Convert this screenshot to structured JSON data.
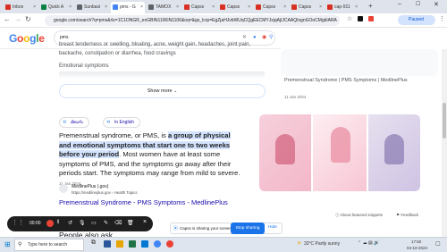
{
  "tabs": [
    {
      "label": "Inbox",
      "color": "#d93025"
    },
    {
      "label": "Quick A",
      "color": "#0b8043"
    },
    {
      "label": "Sunbasi",
      "color": "#5f6368"
    },
    {
      "label": "pms - G",
      "color": "#4285f4"
    },
    {
      "label": "TAMOX",
      "color": "#5f6368"
    },
    {
      "label": "Capss",
      "color": "#d93025"
    },
    {
      "label": "Capss",
      "color": "#d93025"
    },
    {
      "label": "Capss",
      "color": "#d93025"
    },
    {
      "label": "Capss",
      "color": "#d93025"
    },
    {
      "label": "cap-911",
      "color": "#d93025"
    }
  ],
  "address": "google.com/search?q=pms&rlz=1C1ONGR_enGBIN1106IN1106&oq=&gs_lcrp=EgZjaHJvbWUqCQgEECMYJxjqAjIJCAAQIxgnGOoCMgkIARA",
  "paused_label": "Paused",
  "google_logo": "Google",
  "search_query": "pms",
  "profile_initial": "h",
  "top_text": {
    "line1": "breast tenderness or swelling, bloating, acne, weight gain, headaches, joint pain,",
    "line2": "backache, constipation or diarrhea, food cravings",
    "heading": "Emotional symptoms"
  },
  "show_more": "Show more",
  "side_link": "Premenstrual Syndrome | PMS Symptoms | MedlinePlus",
  "side_date": "11 Jan 2024",
  "lang_chips": [
    "తెలుగు",
    "In English"
  ],
  "snippet": {
    "pre": "Premenstrual syndrome, or PMS, is ",
    "highlight": "a group of physical and emotional symptoms that start one to two weeks before your period",
    "post": ". Most women have at least some symptoms of PMS, and the symptoms go away after their periods start. The symptoms may range from mild to severe.",
    "date": "11 Jan 2024"
  },
  "source": {
    "name": "MedlinePlus (.gov)",
    "url": "https://medlineplus.gov › Health Topics",
    "title": "Premenstrual Syndrome - PMS Symptoms - MedlinePlus"
  },
  "about_snippets": "About featured snippets",
  "feedback": "Feedback",
  "people_ask": "People also ask",
  "recorder": {
    "time": "00:00",
    "sharing_text": "Capss is sharing your screen.",
    "stop_label": "Stop sharing",
    "hide_label": "Hide"
  },
  "taskbar": {
    "search_placeholder": "Type here to search",
    "weather": "33°C Partly sunny",
    "time": "17:50",
    "date": "04-10-2024"
  }
}
